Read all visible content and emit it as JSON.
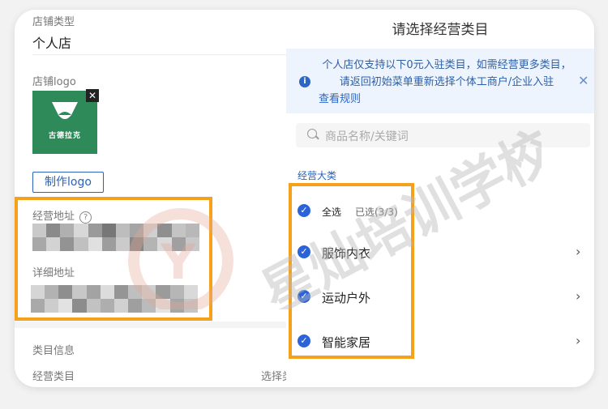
{
  "left": {
    "shop_type_label": "店铺类型",
    "shop_type_value": "个人店",
    "shop_logo_label": "店铺logo",
    "logo_text": "古德拉克",
    "make_logo_button": "制作logo",
    "business_address_label": "经营地址",
    "help_icon": "question-circle-icon",
    "detail_address_label": "详细地址",
    "category_info_label": "类目信息",
    "business_category_label": "经营类目",
    "select_category_text": "选择类"
  },
  "panel": {
    "title": "请选择经营类目",
    "notice_text": "个人店仅支持以下0元入驻类目，如需经营更多类目，请返回初始菜单重新选择个体工商户/企业入驻",
    "notice_link": "查看规则",
    "notice_close": "✕",
    "search_placeholder": "商品名称/关键词",
    "section_label": "经营大类",
    "select_all_label": "全选",
    "selected_count": "已选(3/3)",
    "categories": [
      {
        "label": "服饰内衣"
      },
      {
        "label": "运动户外"
      },
      {
        "label": "智能家居"
      }
    ]
  },
  "watermark": {
    "text": "星灿培训学校",
    "color": "#e3a596"
  },
  "colors": {
    "accent": "#2b63d8",
    "highlight": "#f5a11c",
    "logo_bg": "#2f8a5a"
  }
}
